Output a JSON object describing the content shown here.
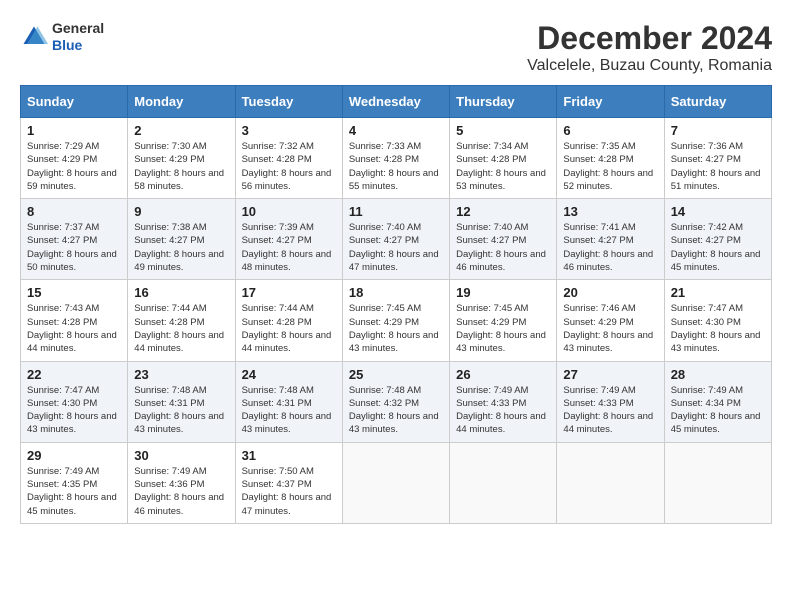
{
  "header": {
    "logo_general": "General",
    "logo_blue": "Blue",
    "month": "December 2024",
    "location": "Valcelele, Buzau County, Romania"
  },
  "days_of_week": [
    "Sunday",
    "Monday",
    "Tuesday",
    "Wednesday",
    "Thursday",
    "Friday",
    "Saturday"
  ],
  "weeks": [
    [
      {
        "day": "1",
        "sunrise": "Sunrise: 7:29 AM",
        "sunset": "Sunset: 4:29 PM",
        "daylight": "Daylight: 8 hours and 59 minutes."
      },
      {
        "day": "2",
        "sunrise": "Sunrise: 7:30 AM",
        "sunset": "Sunset: 4:29 PM",
        "daylight": "Daylight: 8 hours and 58 minutes."
      },
      {
        "day": "3",
        "sunrise": "Sunrise: 7:32 AM",
        "sunset": "Sunset: 4:28 PM",
        "daylight": "Daylight: 8 hours and 56 minutes."
      },
      {
        "day": "4",
        "sunrise": "Sunrise: 7:33 AM",
        "sunset": "Sunset: 4:28 PM",
        "daylight": "Daylight: 8 hours and 55 minutes."
      },
      {
        "day": "5",
        "sunrise": "Sunrise: 7:34 AM",
        "sunset": "Sunset: 4:28 PM",
        "daylight": "Daylight: 8 hours and 53 minutes."
      },
      {
        "day": "6",
        "sunrise": "Sunrise: 7:35 AM",
        "sunset": "Sunset: 4:28 PM",
        "daylight": "Daylight: 8 hours and 52 minutes."
      },
      {
        "day": "7",
        "sunrise": "Sunrise: 7:36 AM",
        "sunset": "Sunset: 4:27 PM",
        "daylight": "Daylight: 8 hours and 51 minutes."
      }
    ],
    [
      {
        "day": "8",
        "sunrise": "Sunrise: 7:37 AM",
        "sunset": "Sunset: 4:27 PM",
        "daylight": "Daylight: 8 hours and 50 minutes."
      },
      {
        "day": "9",
        "sunrise": "Sunrise: 7:38 AM",
        "sunset": "Sunset: 4:27 PM",
        "daylight": "Daylight: 8 hours and 49 minutes."
      },
      {
        "day": "10",
        "sunrise": "Sunrise: 7:39 AM",
        "sunset": "Sunset: 4:27 PM",
        "daylight": "Daylight: 8 hours and 48 minutes."
      },
      {
        "day": "11",
        "sunrise": "Sunrise: 7:40 AM",
        "sunset": "Sunset: 4:27 PM",
        "daylight": "Daylight: 8 hours and 47 minutes."
      },
      {
        "day": "12",
        "sunrise": "Sunrise: 7:40 AM",
        "sunset": "Sunset: 4:27 PM",
        "daylight": "Daylight: 8 hours and 46 minutes."
      },
      {
        "day": "13",
        "sunrise": "Sunrise: 7:41 AM",
        "sunset": "Sunset: 4:27 PM",
        "daylight": "Daylight: 8 hours and 46 minutes."
      },
      {
        "day": "14",
        "sunrise": "Sunrise: 7:42 AM",
        "sunset": "Sunset: 4:27 PM",
        "daylight": "Daylight: 8 hours and 45 minutes."
      }
    ],
    [
      {
        "day": "15",
        "sunrise": "Sunrise: 7:43 AM",
        "sunset": "Sunset: 4:28 PM",
        "daylight": "Daylight: 8 hours and 44 minutes."
      },
      {
        "day": "16",
        "sunrise": "Sunrise: 7:44 AM",
        "sunset": "Sunset: 4:28 PM",
        "daylight": "Daylight: 8 hours and 44 minutes."
      },
      {
        "day": "17",
        "sunrise": "Sunrise: 7:44 AM",
        "sunset": "Sunset: 4:28 PM",
        "daylight": "Daylight: 8 hours and 44 minutes."
      },
      {
        "day": "18",
        "sunrise": "Sunrise: 7:45 AM",
        "sunset": "Sunset: 4:29 PM",
        "daylight": "Daylight: 8 hours and 43 minutes."
      },
      {
        "day": "19",
        "sunrise": "Sunrise: 7:45 AM",
        "sunset": "Sunset: 4:29 PM",
        "daylight": "Daylight: 8 hours and 43 minutes."
      },
      {
        "day": "20",
        "sunrise": "Sunrise: 7:46 AM",
        "sunset": "Sunset: 4:29 PM",
        "daylight": "Daylight: 8 hours and 43 minutes."
      },
      {
        "day": "21",
        "sunrise": "Sunrise: 7:47 AM",
        "sunset": "Sunset: 4:30 PM",
        "daylight": "Daylight: 8 hours and 43 minutes."
      }
    ],
    [
      {
        "day": "22",
        "sunrise": "Sunrise: 7:47 AM",
        "sunset": "Sunset: 4:30 PM",
        "daylight": "Daylight: 8 hours and 43 minutes."
      },
      {
        "day": "23",
        "sunrise": "Sunrise: 7:48 AM",
        "sunset": "Sunset: 4:31 PM",
        "daylight": "Daylight: 8 hours and 43 minutes."
      },
      {
        "day": "24",
        "sunrise": "Sunrise: 7:48 AM",
        "sunset": "Sunset: 4:31 PM",
        "daylight": "Daylight: 8 hours and 43 minutes."
      },
      {
        "day": "25",
        "sunrise": "Sunrise: 7:48 AM",
        "sunset": "Sunset: 4:32 PM",
        "daylight": "Daylight: 8 hours and 43 minutes."
      },
      {
        "day": "26",
        "sunrise": "Sunrise: 7:49 AM",
        "sunset": "Sunset: 4:33 PM",
        "daylight": "Daylight: 8 hours and 44 minutes."
      },
      {
        "day": "27",
        "sunrise": "Sunrise: 7:49 AM",
        "sunset": "Sunset: 4:33 PM",
        "daylight": "Daylight: 8 hours and 44 minutes."
      },
      {
        "day": "28",
        "sunrise": "Sunrise: 7:49 AM",
        "sunset": "Sunset: 4:34 PM",
        "daylight": "Daylight: 8 hours and 45 minutes."
      }
    ],
    [
      {
        "day": "29",
        "sunrise": "Sunrise: 7:49 AM",
        "sunset": "Sunset: 4:35 PM",
        "daylight": "Daylight: 8 hours and 45 minutes."
      },
      {
        "day": "30",
        "sunrise": "Sunrise: 7:49 AM",
        "sunset": "Sunset: 4:36 PM",
        "daylight": "Daylight: 8 hours and 46 minutes."
      },
      {
        "day": "31",
        "sunrise": "Sunrise: 7:50 AM",
        "sunset": "Sunset: 4:37 PM",
        "daylight": "Daylight: 8 hours and 47 minutes."
      },
      null,
      null,
      null,
      null
    ]
  ]
}
